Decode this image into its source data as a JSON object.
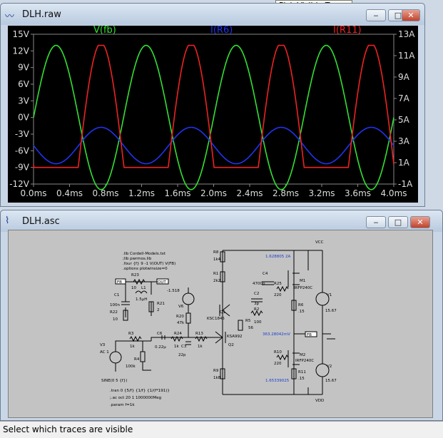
{
  "tooltip": "Pick Visible Traces",
  "plot_window": {
    "title": "DLH.raw",
    "icon": "waveform-icon",
    "buttons": {
      "minimize": "‒",
      "maximize": "□",
      "close": "✕"
    }
  },
  "schematic_window": {
    "title": "DLH.asc",
    "icon": "schematic-icon",
    "buttons": {
      "minimize": "‒",
      "maximize": "□",
      "close": "✕"
    }
  },
  "status_bar": {
    "text": "Select which traces are visible"
  },
  "colors": {
    "vfb": "#33e033",
    "ir6": "#2233ee",
    "ir11": "#ee2222",
    "plot_bg": "#000000",
    "axis_text": "#dddddd"
  },
  "chart_data": {
    "type": "line",
    "x_ticks": [
      "0.0ms",
      "0.4ms",
      "0.8ms",
      "1.2ms",
      "1.6ms",
      "2.0ms",
      "2.4ms",
      "2.8ms",
      "3.2ms",
      "3.6ms",
      "4.0ms"
    ],
    "xlim": [
      0,
      4
    ],
    "left_ticks": [
      "15V",
      "12V",
      "9V",
      "6V",
      "3V",
      "0V",
      "-3V",
      "-6V",
      "-9V",
      "-12V"
    ],
    "ylim_left": [
      -12,
      15
    ],
    "right_ticks": [
      "13A",
      "11A",
      "9A",
      "7A",
      "5A",
      "3A",
      "1A",
      "-1A"
    ],
    "ylim_right": [
      -1,
      13
    ],
    "series": [
      {
        "name": "V(fb)",
        "axis": "left",
        "period_ms": 1,
        "offset": 0,
        "amplitude": 13,
        "phase_deg": 0
      },
      {
        "name": "I(R6)",
        "axis": "right",
        "period_ms": 1,
        "offset": 2.6,
        "amplitude": 1.7,
        "phase_deg": 180
      },
      {
        "name": "I(R11)",
        "axis": "left",
        "period_ms": 1,
        "offset": -8.4,
        "amplitude": 21.8,
        "phase_deg": 180,
        "clip": [
          -9,
          13
        ]
      }
    ]
  },
  "schematic": {
    "directives": [
      ".lib Cordell-Models.txt",
      ";lib pwrmos.lib",
      ".four {f} 9 -1 V(OUT) V(FB)",
      ".options plotwinsize=0"
    ],
    "sim_lines": [
      ".tran 0 {5/f} {1/f} {1/(f*191)}",
      ";.ac oct 20 1 1000000Meg",
      ".param f=1k"
    ],
    "nets": {
      "fb": "FB",
      "out": "OUT",
      "vcc": "VCC",
      "vdd": "VDD"
    },
    "labels": {
      "r23": "R23",
      "r23v": "10",
      "l1": "L1",
      "l1v": "1.5µH",
      "r21": "R21",
      "r21v": "2",
      "c1": "C1",
      "c1v": "100n",
      "r22": "R22",
      "r22v": "10",
      "v6v": "-1.518",
      "v6": "V6",
      "r20": "R20",
      "r20v": "47k",
      "c3": "C3",
      "c3v": "22p",
      "r3": "R3",
      "r3v": "1k",
      "c6": "C6",
      "c6v": "0.22µ",
      "r24": "R24",
      "r24v": "1k",
      "r13": "R13",
      "r13v": "1k",
      "v3": "V3",
      "v3ac": "AC 1",
      "v3sine": "SINE(0 5 {f})",
      "r4": "R4",
      "r4v": "100k",
      "r8": "R8",
      "r8v": "1k4",
      "r1": "R1",
      "r1v": "2k2",
      "q1": "Q1",
      "q1m": "KSC1845",
      "r5": "R5",
      "r5v": "56",
      "q2": "Q2",
      "q2m": "KSA992",
      "r9": "R9",
      "r9v": "1k8",
      "c4": "C4",
      "c4v": "4700p",
      "c2": "C2",
      "c2v": "3p",
      "r2": "R2",
      "r2v": "100",
      "r25": "R25",
      "r25v": "220",
      "m1": "M1",
      "m1m": "IRFP240C",
      "r6": "R6",
      "r6v": ".15",
      "r10": "R10",
      "r10v": "220",
      "m2": "M2",
      "m2m": "IRFP240C",
      "r11": "R11",
      "r11v": ".15",
      "v1": "V1",
      "v1v": "15.67",
      "v2": "V2",
      "v2v": "15.67",
      "op1": "1.628805 2A",
      "op2": "363.28042mV",
      "op3": "1.65339025"
    }
  }
}
